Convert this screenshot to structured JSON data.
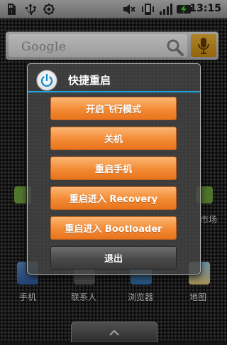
{
  "status_bar": {
    "time": "13:15",
    "left_icons": [
      "sd-card-icon",
      "usb-icon",
      "usb-debug-icon"
    ],
    "right_icons": [
      "mute-icon",
      "vibrate-icon",
      "signal-icon",
      "battery-charging-icon"
    ]
  },
  "search_widget": {
    "logo_text": "Google",
    "search_icon": "search-icon",
    "mic_icon": "mic-icon",
    "mic_color": "#d99b20"
  },
  "dialog": {
    "title": "快捷重启",
    "icon": "power-icon",
    "divider_color": "#1fa0d8",
    "buttons": [
      {
        "label": "开启飞行模式"
      },
      {
        "label": "关机"
      },
      {
        "label": "重启手机"
      },
      {
        "label": "重启进入 Recovery"
      },
      {
        "label": "重启进入 Bootloader"
      },
      {
        "label": "退出"
      }
    ],
    "button_color": "#f38a35"
  },
  "home_screen": {
    "partial_label_right": "市场",
    "dock_labels": [
      "手机",
      "联系人",
      "浏览器",
      "地图"
    ]
  }
}
